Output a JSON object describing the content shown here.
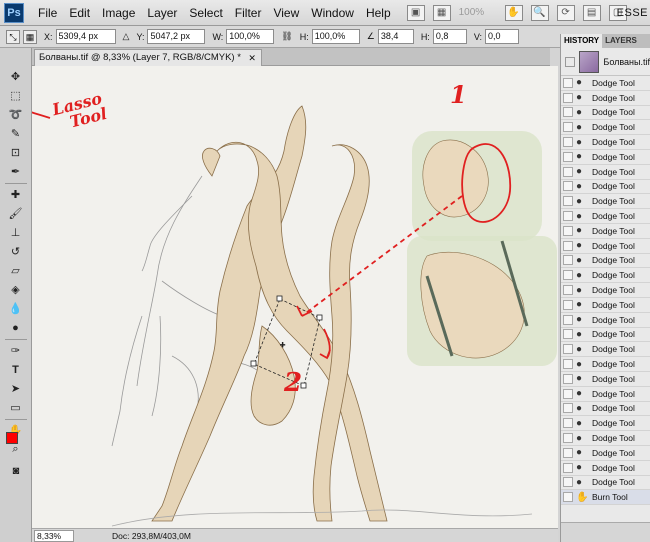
{
  "app": {
    "logo": "Ps",
    "workspace": "ESSE"
  },
  "menu": [
    "File",
    "Edit",
    "Image",
    "Layer",
    "Select",
    "Filter",
    "View",
    "Window",
    "Help"
  ],
  "menubar_zoom": "100%",
  "options": {
    "x_label": "X:",
    "x_value": "5309,4 px",
    "y_label": "Y:",
    "y_value": "5047,2 px",
    "w_label": "W:",
    "w_value": "100,0%",
    "h_label": "H:",
    "h_value": "100,0%",
    "angle_value": "38,4",
    "hskew_label": "H:",
    "hskew_value": "0,8",
    "vskew_label": "V:",
    "vskew_value": "0,0"
  },
  "document": {
    "tab_title": "Болваны.tif @ 8,33% (Layer 7, RGB/8/CMYK) *",
    "zoom": "8,33%",
    "doc_size": "Doc: 293,8M/403,0M"
  },
  "annotations": {
    "lasso_label_line1": "Lasso",
    "lasso_label_line2": "Tool",
    "step1": "1",
    "step2": "2"
  },
  "tools": [
    "move",
    "marquee",
    "lasso",
    "quick-select",
    "crop",
    "eyedropper",
    "healing",
    "brush",
    "stamp",
    "history-brush",
    "eraser",
    "gradient",
    "blur",
    "dodge",
    "pen",
    "type",
    "path-select",
    "shape",
    "hand",
    "zoom"
  ],
  "colors": {
    "foreground": "#ff0000",
    "background": "#ffffff",
    "annotation": "#e02020"
  },
  "history": {
    "tabs": [
      "HISTORY",
      "LAYERS"
    ],
    "snapshot_name": "Болваны.tif",
    "items": [
      "Dodge Tool",
      "Dodge Tool",
      "Dodge Tool",
      "Dodge Tool",
      "Dodge Tool",
      "Dodge Tool",
      "Dodge Tool",
      "Dodge Tool",
      "Dodge Tool",
      "Dodge Tool",
      "Dodge Tool",
      "Dodge Tool",
      "Dodge Tool",
      "Dodge Tool",
      "Dodge Tool",
      "Dodge Tool",
      "Dodge Tool",
      "Dodge Tool",
      "Dodge Tool",
      "Dodge Tool",
      "Dodge Tool",
      "Dodge Tool",
      "Dodge Tool",
      "Dodge Tool",
      "Dodge Tool",
      "Dodge Tool",
      "Dodge Tool",
      "Dodge Tool",
      "Burn Tool"
    ]
  }
}
